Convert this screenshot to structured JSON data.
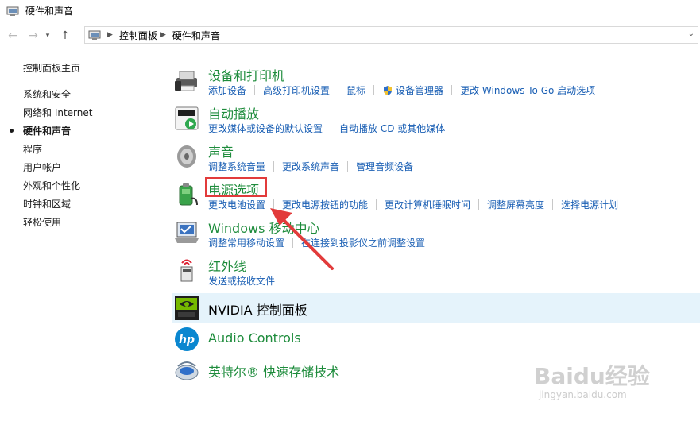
{
  "window": {
    "title": "硬件和声音"
  },
  "address": {
    "crumbs": [
      "控制面板",
      "硬件和声音"
    ]
  },
  "sidebar": {
    "home": "控制面板主页",
    "items": [
      {
        "label": "系统和安全"
      },
      {
        "label": "网络和 Internet"
      },
      {
        "label": "硬件和声音",
        "current": true
      },
      {
        "label": "程序"
      },
      {
        "label": "用户帐户"
      },
      {
        "label": "外观和个性化"
      },
      {
        "label": "时钟和区域"
      },
      {
        "label": "轻松使用"
      }
    ]
  },
  "categories": [
    {
      "title": "设备和打印机",
      "icon": "printer-device-icon",
      "links": [
        "添加设备",
        "高级打印机设置",
        "鼠标",
        "设备管理器",
        "更改 Windows To Go 启动选项"
      ]
    },
    {
      "title": "自动播放",
      "icon": "autoplay-icon",
      "links": [
        "更改媒体或设备的默认设置",
        "自动播放 CD 或其他媒体"
      ]
    },
    {
      "title": "声音",
      "icon": "speaker-icon",
      "links": [
        "调整系统音量",
        "更改系统声音",
        "管理音频设备"
      ]
    },
    {
      "title": "电源选项",
      "icon": "power-battery-icon",
      "links": [
        "更改电池设置",
        "更改电源按钮的功能",
        "更改计算机睡眠时间",
        "调整屏幕亮度",
        "选择电源计划"
      ]
    },
    {
      "title": "Windows 移动中心",
      "icon": "mobility-center-icon",
      "links": [
        "调整常用移动设置",
        "在连接到投影仪之前调整设置"
      ]
    },
    {
      "title": "红外线",
      "icon": "infrared-icon",
      "links": [
        "发送或接收文件"
      ]
    },
    {
      "title": "NVIDIA 控制面板",
      "icon": "nvidia-icon",
      "links": []
    },
    {
      "title": "Audio Controls",
      "icon": "hp-icon",
      "links": []
    },
    {
      "title": "英特尔® 快速存储技术",
      "icon": "intel-storage-icon",
      "links": []
    }
  ],
  "watermark": {
    "text1": "Baidu经验",
    "text2": "jingyan.baidu.com"
  },
  "colors": {
    "link": "#1a5fb4",
    "category_title": "#1e8c3c",
    "highlight_box": "#e23b3b",
    "arrow": "#e23b3b"
  }
}
